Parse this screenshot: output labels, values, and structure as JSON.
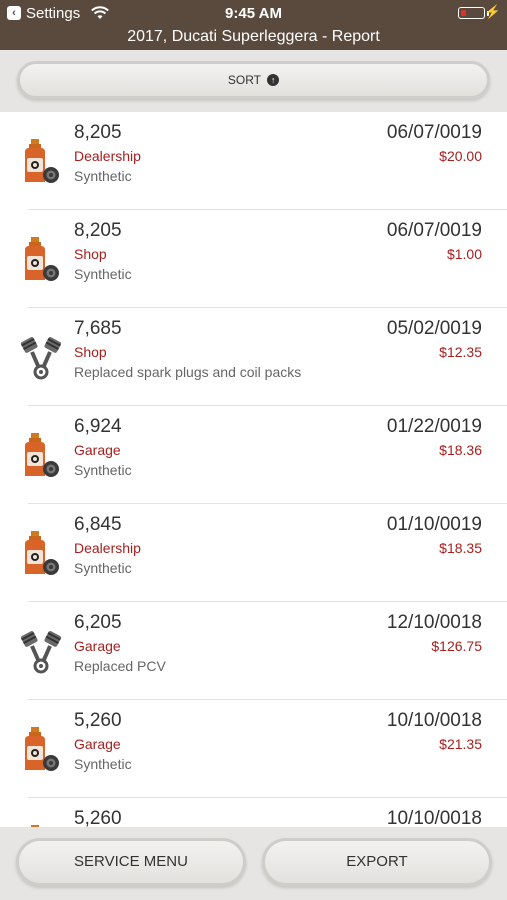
{
  "status_bar": {
    "back_app": "Settings",
    "time": "9:45 AM"
  },
  "nav": {
    "title": "2017, Ducati Superleggera - Report"
  },
  "sort": {
    "label": "SORT",
    "icon": "arrow-up-circle-icon"
  },
  "records": [
    {
      "mileage": "8,205",
      "location": "Dealership",
      "note": "Synthetic",
      "date": "06/07/0019",
      "cost": "$20.00",
      "icon": "oil-bottle-icon"
    },
    {
      "mileage": "8,205",
      "location": "Shop",
      "note": "Synthetic",
      "date": "06/07/0019",
      "cost": "$1.00",
      "icon": "oil-bottle-icon"
    },
    {
      "mileage": "7,685",
      "location": "Shop",
      "note": "Replaced spark plugs and coil packs",
      "date": "05/02/0019",
      "cost": "$12.35",
      "icon": "pistons-icon"
    },
    {
      "mileage": "6,924",
      "location": "Garage",
      "note": "Synthetic",
      "date": "01/22/0019",
      "cost": "$18.36",
      "icon": "oil-bottle-icon"
    },
    {
      "mileage": "6,845",
      "location": "Dealership",
      "note": "Synthetic",
      "date": "01/10/0019",
      "cost": "$18.35",
      "icon": "oil-bottle-icon"
    },
    {
      "mileage": "6,205",
      "location": "Garage",
      "note": "Replaced PCV",
      "date": "12/10/0018",
      "cost": "$126.75",
      "icon": "pistons-icon"
    },
    {
      "mileage": "5,260",
      "location": "Garage",
      "note": "Synthetic",
      "date": "10/10/0018",
      "cost": "$21.35",
      "icon": "oil-bottle-icon"
    },
    {
      "mileage": "5,260",
      "location": "",
      "note": "",
      "date": "10/10/0018",
      "cost": "",
      "icon": "oil-bottle-icon"
    }
  ],
  "bottom": {
    "service_menu_label": "SERVICE MENU",
    "export_label": "EXPORT"
  },
  "colors": {
    "header_bg": "#5a4a3e",
    "accent_red": "#a6201f",
    "toolbar_bg": "#e6e5e3"
  }
}
